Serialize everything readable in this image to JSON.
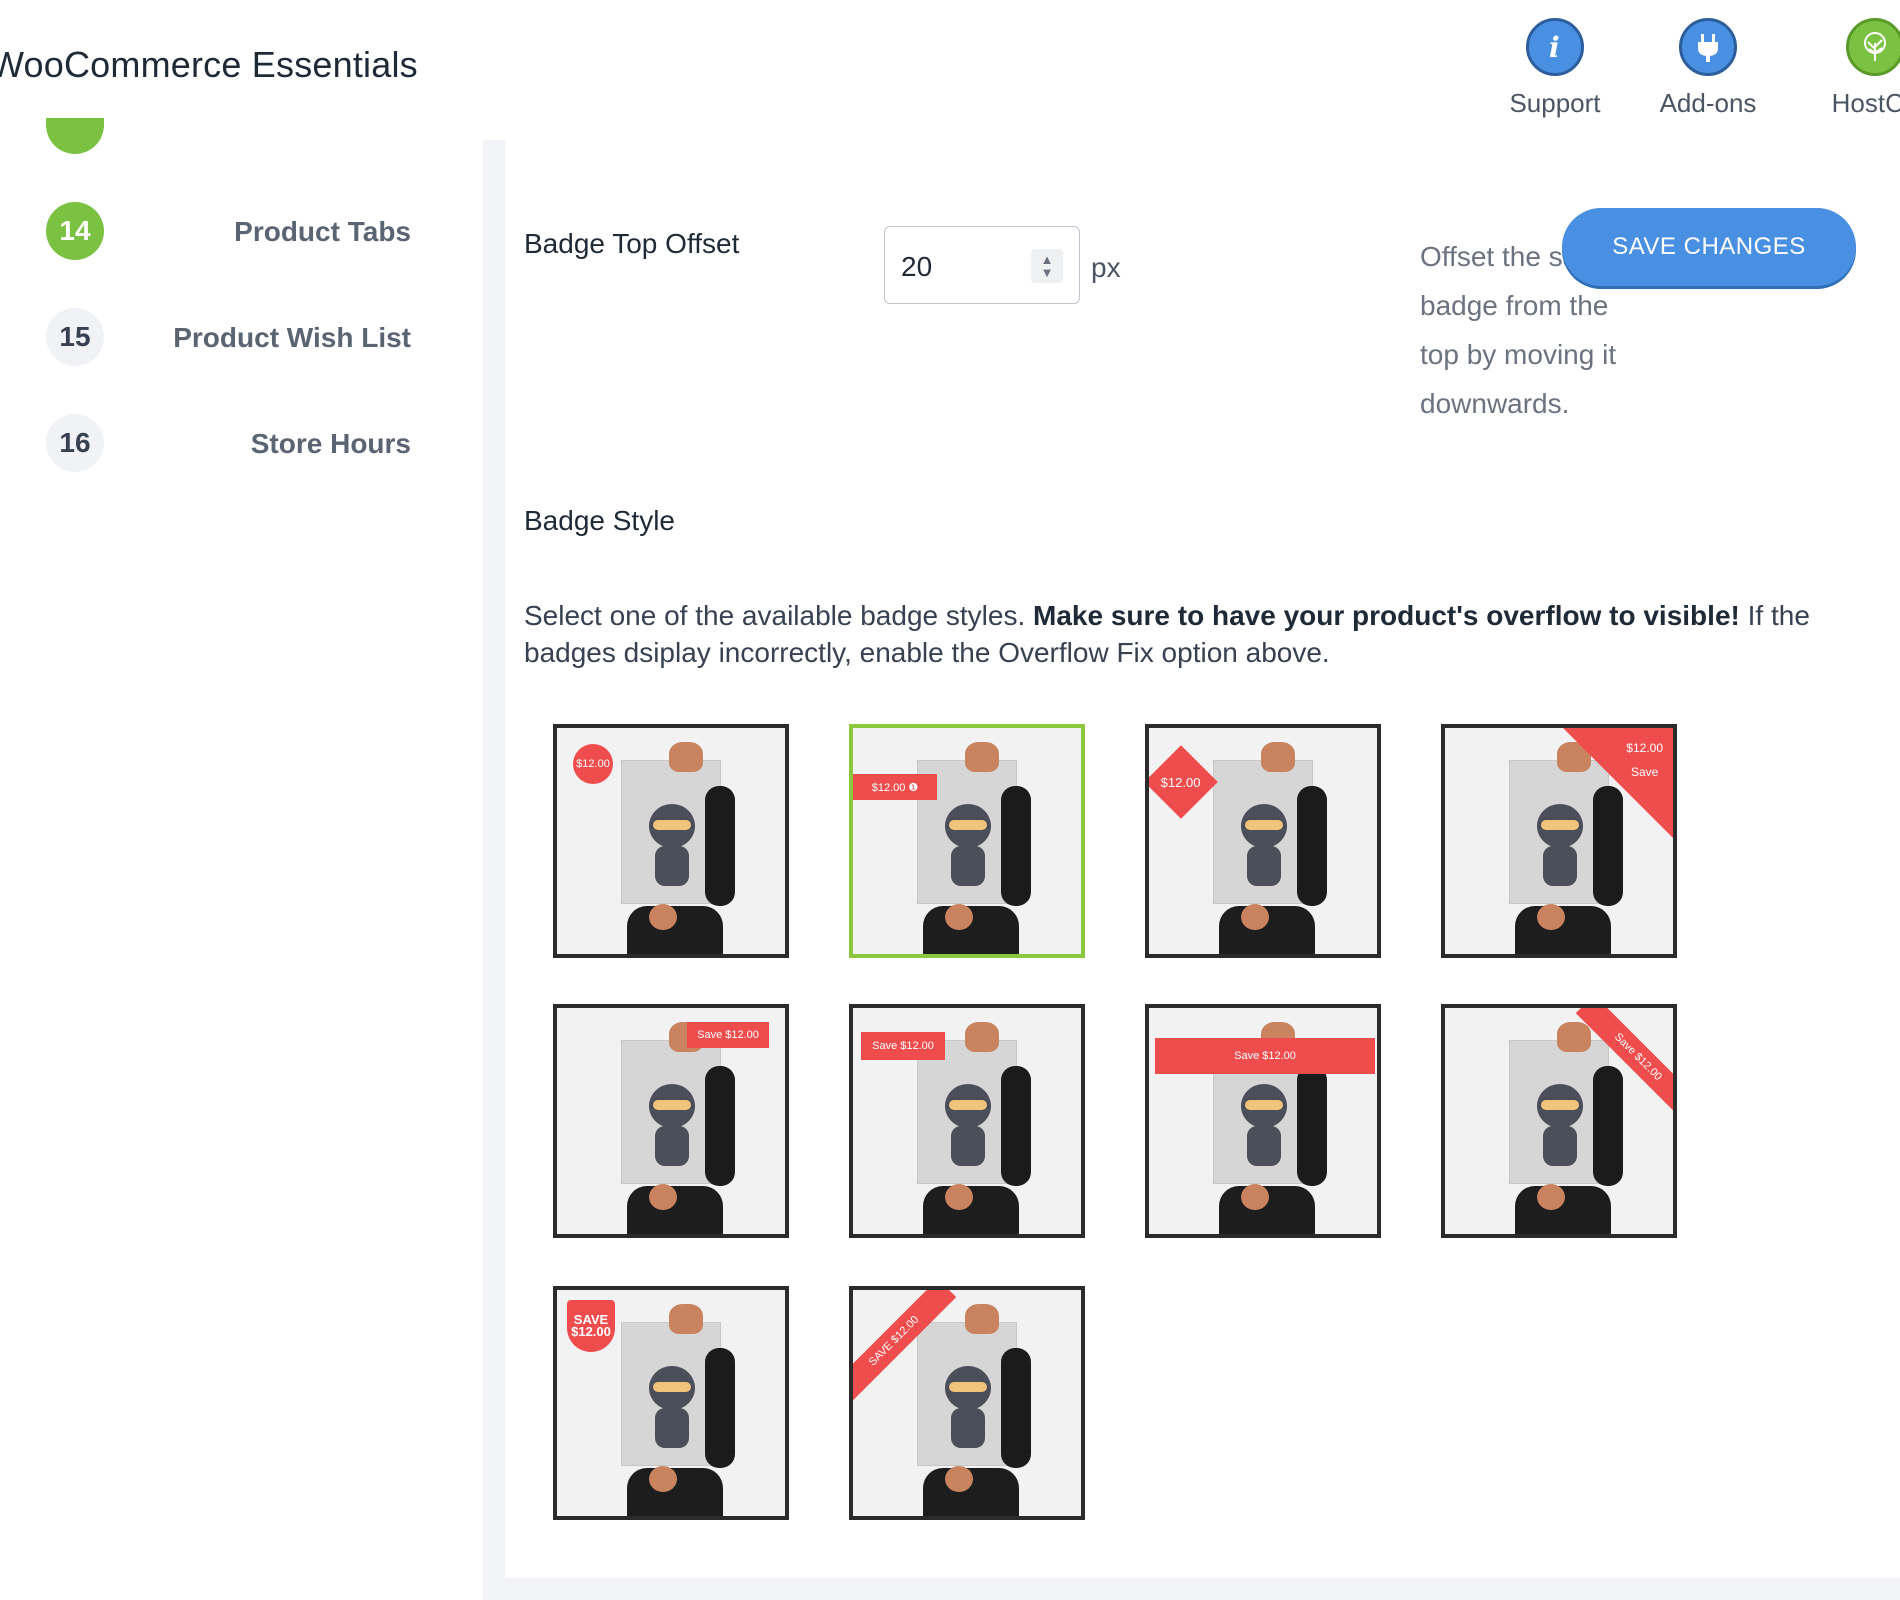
{
  "header": {
    "title": "WooCommerce Essentials",
    "links": [
      {
        "label": "Support",
        "icon": "info-icon"
      },
      {
        "label": "Add-ons",
        "icon": "plug-icon"
      },
      {
        "label": "HostCo",
        "icon": "tree-logo-icon"
      }
    ]
  },
  "sidebar": {
    "items": [
      {
        "num": "14",
        "label": "Product Tabs",
        "active": true
      },
      {
        "num": "15",
        "label": "Product Wish List",
        "active": false
      },
      {
        "num": "16",
        "label": "Store Hours",
        "active": false
      }
    ]
  },
  "offset": {
    "label": "Badge Top Offset",
    "value": "20",
    "unit": "px",
    "description": "Offset the sale badge from the top by moving it downwards."
  },
  "save_button": "SAVE CHANGES",
  "badge_style": {
    "title": "Badge Style",
    "desc_prefix": "Select one of the available badge styles. ",
    "desc_bold": "Make sure to have your product's overflow to visible!",
    "desc_suffix": " If the badges dsiplay incorrectly, enable the Overflow Fix option above.",
    "selected_index": 2,
    "badges": [
      {
        "text": "$12.00"
      },
      {
        "text": "$12.00 ❶"
      },
      {
        "text": "$12.00"
      },
      {
        "text": "$12.00",
        "sub": "Save"
      },
      {
        "text": "Save $12.00"
      },
      {
        "text": "Save $12.00"
      },
      {
        "text": "Save $12.00"
      },
      {
        "text": "Save $12.00"
      },
      {
        "text": "SAVE",
        "sub": "$12.00"
      },
      {
        "text": "SAVE $12.00"
      }
    ]
  },
  "colors": {
    "accent_green": "#7cc242",
    "button_blue": "#4a90e2",
    "badge_red": "#ef4d4d"
  }
}
